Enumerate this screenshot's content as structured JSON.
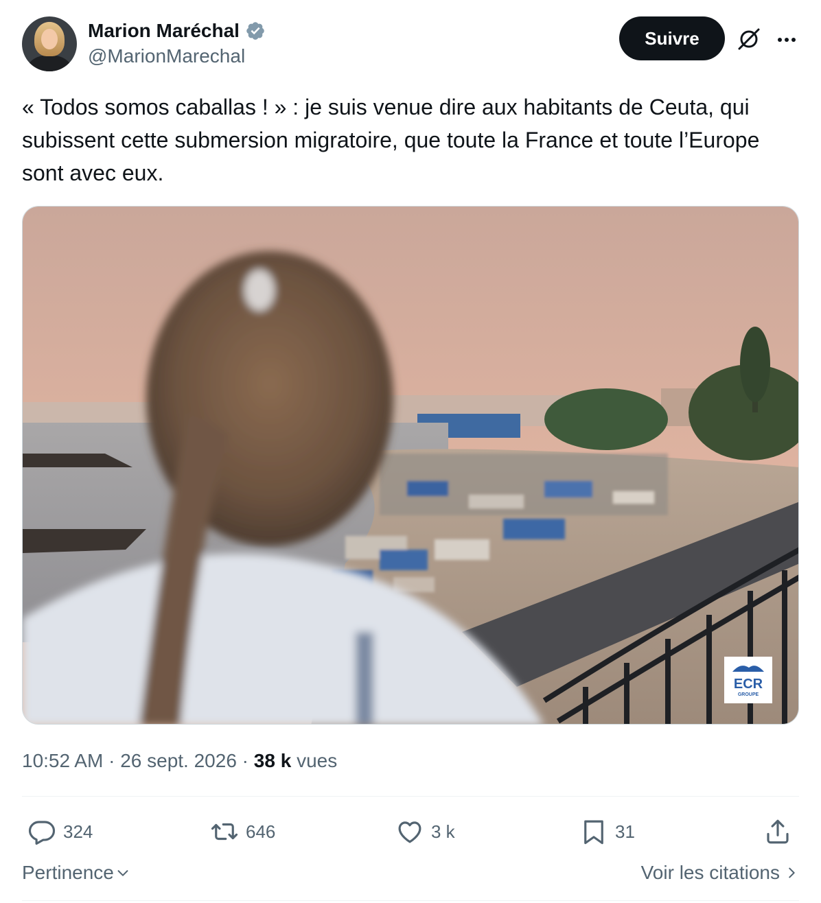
{
  "author": {
    "display_name": "Marion Maréchal",
    "handle": "@MarionMarechal"
  },
  "follow_label": "Suivre",
  "tweet": {
    "text": "« Todos somos caballas ! » : je suis venue dire aux habitants de Ceuta, qui subissent cette submersion migratoire, que toute la France et toute l’Europe sont avec eux."
  },
  "media": {
    "watermark_line1": "ECR",
    "watermark_line2": "GROUPE"
  },
  "meta": {
    "time": "10:52 AM",
    "sep1": " · ",
    "date": "26 sept. 2026",
    "sep2": " · ",
    "views_count": "38 k",
    "views_label": " vues"
  },
  "actions": {
    "replies": "324",
    "reposts": "646",
    "likes": "3 k",
    "bookmarks": "31"
  },
  "footer": {
    "sort_label": "Pertinence",
    "quotes_label": "Voir les citations"
  },
  "colors": {
    "text_primary": "#0f1419",
    "text_secondary": "#536471",
    "verified": "#829aab",
    "button_bg": "#0f1419"
  }
}
